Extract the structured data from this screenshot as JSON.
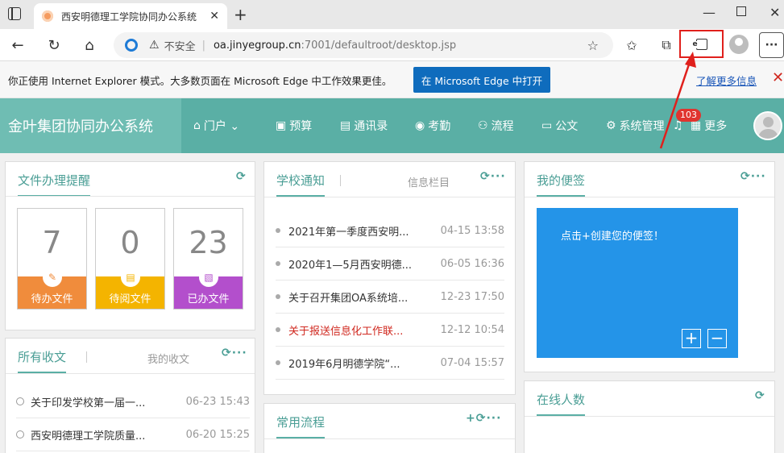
{
  "browser": {
    "tab_title": "西安明德理工学院协同办公系统",
    "tab_close": "✕",
    "new_tab": "+",
    "url_security": "不安全",
    "url_host": "oa.jinyegroup.cn",
    "url_path": ":7001/defaultroot/desktop.jsp",
    "more": "···"
  },
  "ie_bar": {
    "message": "你正使用 Internet Explorer 模式。大多数页面在 Microsoft Edge 中工作效果更佳。",
    "open_button": "在 Microsoft Edge 中打开",
    "learn_more": "了解更多信息",
    "close": "✕"
  },
  "oa": {
    "brand": "金叶集团协同办公系统",
    "nav": [
      {
        "icon": "home-icon",
        "glyph": "⌂",
        "label": "门户 ⌄"
      },
      {
        "icon": "budget-icon",
        "glyph": "▣",
        "label": "预算"
      },
      {
        "icon": "contacts-icon",
        "glyph": "▤",
        "label": "通讯录"
      },
      {
        "icon": "location-icon",
        "glyph": "◉",
        "label": "考勤"
      },
      {
        "icon": "flow-icon",
        "glyph": "⚇",
        "label": "流程"
      },
      {
        "icon": "briefcase-icon",
        "glyph": "▭",
        "label": "公文"
      },
      {
        "icon": "gear-icon",
        "glyph": "⚙",
        "label": "系统管理"
      },
      {
        "icon": "grid-icon",
        "glyph": "▦",
        "label": "更多"
      }
    ],
    "notification_count": "103"
  },
  "panel_files": {
    "title": "文件办理提醒",
    "cards": [
      {
        "count": "7",
        "label": "待办文件",
        "color": "#f08c3c",
        "icon": "pencil-icon",
        "glyph": "✎"
      },
      {
        "count": "0",
        "label": "待阅文件",
        "color": "#f4b400",
        "icon": "document-icon",
        "glyph": "▤"
      },
      {
        "count": "23",
        "label": "已办文件",
        "color": "#b34fcc",
        "icon": "done-doc-icon",
        "glyph": "▧"
      }
    ]
  },
  "panel_notice": {
    "title": "学校通知",
    "subtab": "信息栏目",
    "actions": "⟳···",
    "items": [
      {
        "text": "2021年第一季度西安明...",
        "date": "04-15 13:58",
        "red": false
      },
      {
        "text": "2020年1—5月西安明德...",
        "date": "06-05 16:36",
        "red": false
      },
      {
        "text": "关于召开集团OA系统培...",
        "date": "12-23 17:50",
        "red": false
      },
      {
        "text": "关于报送信息化工作联...",
        "date": "12-12 10:54",
        "red": true
      },
      {
        "text": "2019年6月明德学院“...",
        "date": "07-04 15:57",
        "red": false
      }
    ]
  },
  "panel_memo": {
    "title": "我的便签",
    "actions": "⟳···",
    "hint": "点击+创建您的便签！",
    "add": "+",
    "remove": "−"
  },
  "panel_received": {
    "title": "所有收文",
    "subtab": "我的收文",
    "actions": "⟳···",
    "items": [
      {
        "text": "关于印发学校第一届一...",
        "date": "06-23 15:43"
      },
      {
        "text": "西安明德理工学院质量...",
        "date": "06-20 15:25"
      }
    ]
  },
  "panel_flow": {
    "title": "常用流程",
    "actions": "+⟳···"
  },
  "panel_online": {
    "title": "在线人数",
    "actions": "⟳"
  }
}
